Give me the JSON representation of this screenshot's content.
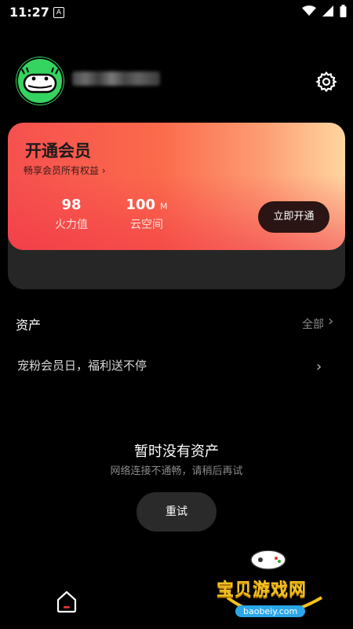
{
  "status_bar": {
    "time": "11:27",
    "notification_icon": "a-badge-icon",
    "icons": [
      "wifi-icon",
      "signal-icon",
      "battery-icon"
    ]
  },
  "profile": {
    "avatar_icon": "smiling-face-avatar",
    "settings_icon": "gear-icon"
  },
  "vip": {
    "title": "开通会员",
    "subtitle": "畅享会员所有权益",
    "stats": [
      {
        "value": "98",
        "unit": "",
        "label": "火力值"
      },
      {
        "value": "100",
        "unit": "M",
        "label": "云空间"
      }
    ],
    "cta": "立即开通",
    "promo": "宠粉会员日，福利送不停",
    "colors": {
      "gradient_start": "#f6504f",
      "gradient_end": "#ffd6a0",
      "cta_bg": "#2a1414"
    }
  },
  "assets": {
    "title": "资产",
    "all_label": "全部",
    "empty_title": "暂时没有资产",
    "empty_sub": "网络连接不通畅，请稍后再试",
    "retry": "重试"
  },
  "nav": {
    "home_icon": "home-icon"
  },
  "watermark": {
    "text": "宝贝游戏网",
    "url": "baobeiy.com"
  }
}
